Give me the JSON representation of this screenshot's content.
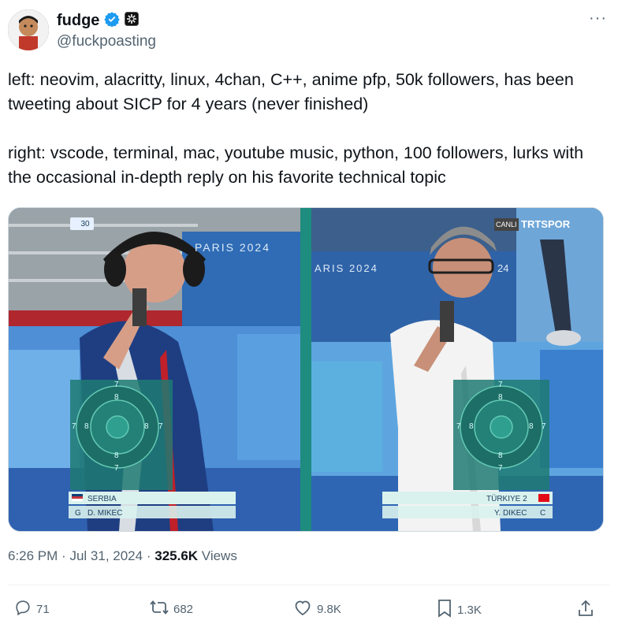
{
  "author": {
    "display_name": "fudge",
    "handle": "@fuckpoasting",
    "verified_color": "#1d9bf0"
  },
  "more_label": "···",
  "tweet": {
    "text": "left: neovim, alacritty, linux, 4chan, C++, anime pfp, 50k followers, has been tweeting about SICP for 4 years (never finished)\n\nright: vscode, terminal, mac, youtube music, python, 100 followers, lurks with the occasional in-depth reply on his favorite technical topic"
  },
  "media": {
    "left": {
      "score_badge": "30",
      "banner": "PARIS 2024",
      "country": "SERBIA",
      "athlete": "D. MIKEC",
      "letter": "G",
      "target_rings": [
        "7",
        "8",
        "7",
        "8",
        "8",
        "7",
        "8",
        "7"
      ]
    },
    "right": {
      "banner": "ARIS 2024",
      "banner2": "24",
      "channel_live": "CANLI",
      "channel_name": "TRTSPOR",
      "country": "TÜRKIYE 2",
      "athlete": "Y. DIKEC",
      "letter": "C",
      "target_rings": [
        "7",
        "8",
        "7",
        "8",
        "8",
        "7",
        "8",
        "7"
      ]
    }
  },
  "meta": {
    "time": "6:26 PM",
    "date": "Jul 31, 2024",
    "views_count": "325.6K",
    "views_label": "Views",
    "sep": "·"
  },
  "actions": {
    "replies": "71",
    "retweets": "682",
    "likes": "9.8K",
    "bookmarks": "1.3K"
  }
}
